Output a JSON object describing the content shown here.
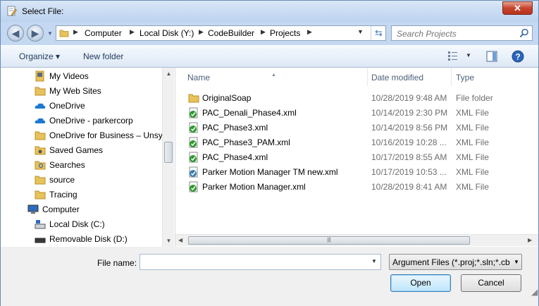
{
  "window": {
    "title": "Select File:",
    "close_label": "✕"
  },
  "address": {
    "crumbs": [
      "Computer",
      "Local Disk (Y:)",
      "CodeBuilder",
      "Projects"
    ],
    "search_placeholder": "Search Projects"
  },
  "toolbar": {
    "organize_label": "Organize ▾",
    "new_folder_label": "New folder"
  },
  "nav": {
    "items": [
      {
        "label": "My Videos",
        "icon": "library-video-icon"
      },
      {
        "label": "My Web Sites",
        "icon": "folder-icon"
      },
      {
        "label": "OneDrive",
        "icon": "onedrive-cloud-icon"
      },
      {
        "label": "OneDrive - parkercorp",
        "icon": "onedrive-cloud-icon"
      },
      {
        "label": "OneDrive for Business – Unsyn",
        "icon": "folder-icon"
      },
      {
        "label": "Saved Games",
        "icon": "saved-games-icon"
      },
      {
        "label": "Searches",
        "icon": "searches-icon"
      },
      {
        "label": "source",
        "icon": "folder-icon"
      },
      {
        "label": "Tracing",
        "icon": "folder-icon"
      },
      {
        "label": "Computer",
        "icon": "computer-icon"
      },
      {
        "label": "Local Disk (C:)",
        "icon": "local-disk-icon"
      },
      {
        "label": "Removable Disk (D:)",
        "icon": "removable-disk-icon"
      }
    ]
  },
  "files": {
    "columns": {
      "name": "Name",
      "date": "Date modified",
      "type": "Type"
    },
    "rows": [
      {
        "name": "OriginalSoap",
        "date": "10/28/2019 9:48 AM",
        "type": "File folder",
        "icon": "folder-icon"
      },
      {
        "name": "PAC_Denali_Phase4.xml",
        "date": "10/14/2019 2:30 PM",
        "type": "XML File",
        "icon": "xml-file-icon"
      },
      {
        "name": "PAC_Phase3.xml",
        "date": "10/14/2019 8:56 PM",
        "type": "XML File",
        "icon": "xml-file-icon"
      },
      {
        "name": "PAC_Phase3_PAM.xml",
        "date": "10/16/2019 10:28 ...",
        "type": "XML File",
        "icon": "xml-file-icon"
      },
      {
        "name": "PAC_Phase4.xml",
        "date": "10/17/2019 8:55 AM",
        "type": "XML File",
        "icon": "xml-file-icon"
      },
      {
        "name": "Parker Motion Manager TM new.xml",
        "date": "10/17/2019 10:53 ...",
        "type": "XML File",
        "icon": "xml-file-icon"
      },
      {
        "name": "Parker Motion Manager.xml",
        "date": "10/28/2019 8:41 AM",
        "type": "XML File",
        "icon": "xml-file-icon"
      }
    ]
  },
  "bottom": {
    "filename_label": "File name:",
    "filename_value": "",
    "filter_value": "Argument Files (*.proj;*.sln;*.cb",
    "open_label": "Open",
    "cancel_label": "Cancel"
  },
  "colors": {
    "title_bar": "#c4d9f1",
    "close_button": "#c7432b",
    "folder": "#e8c25a",
    "xml_check": "#2e9a2e"
  }
}
